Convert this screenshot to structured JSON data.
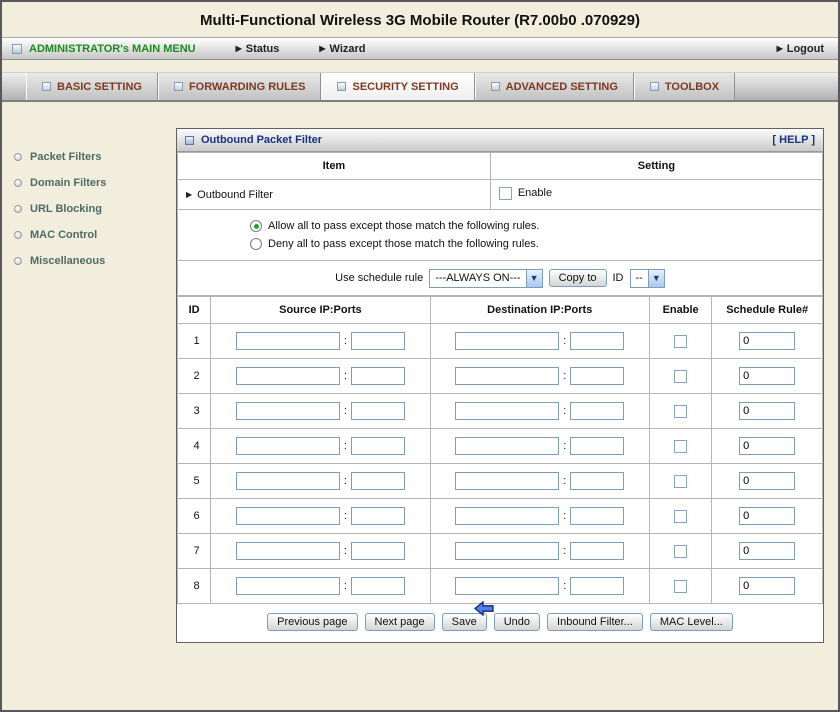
{
  "title": "Multi-Functional Wireless 3G Mobile Router (R7.00b0 .070929)",
  "menubar": {
    "main_menu": "ADMINISTRATOR's MAIN MENU",
    "status": "Status",
    "wizard": "Wizard",
    "logout": "Logout"
  },
  "tabs": [
    {
      "label": "BASIC SETTING",
      "active": false
    },
    {
      "label": "FORWARDING RULES",
      "active": false
    },
    {
      "label": "SECURITY SETTING",
      "active": true
    },
    {
      "label": "ADVANCED SETTING",
      "active": false
    },
    {
      "label": "TOOLBOX",
      "active": false
    }
  ],
  "sidebar": {
    "items": [
      {
        "label": "Packet Filters"
      },
      {
        "label": "Domain Filters"
      },
      {
        "label": "URL Blocking"
      },
      {
        "label": "MAC Control"
      },
      {
        "label": "Miscellaneous"
      }
    ]
  },
  "panel": {
    "title": "Outbound Packet Filter",
    "help": "[ HELP ]",
    "columns": {
      "item": "Item",
      "setting": "Setting"
    },
    "outbound_filter": {
      "label": "Outbound Filter",
      "enable_label": "Enable",
      "enabled": false
    },
    "policy": {
      "allow": {
        "label": "Allow all to pass except those match the following rules.",
        "selected": true
      },
      "deny": {
        "label": "Deny all to pass except those match the following rules.",
        "selected": false
      }
    },
    "schedule": {
      "label": "Use schedule rule",
      "value": "---ALWAYS ON---",
      "copy_button": "Copy to",
      "id_label": "ID",
      "id_value": "--"
    },
    "rules": {
      "headers": {
        "id": "ID",
        "source": "Source IP:Ports",
        "destination": "Destination IP:Ports",
        "enable": "Enable",
        "schedule": "Schedule Rule#"
      },
      "rows": [
        {
          "id": "1",
          "source_ip": "",
          "source_ports": "",
          "dest_ip": "",
          "dest_ports": "",
          "enabled": false,
          "schedule_rule": "0"
        },
        {
          "id": "2",
          "source_ip": "",
          "source_ports": "",
          "dest_ip": "",
          "dest_ports": "",
          "enabled": false,
          "schedule_rule": "0"
        },
        {
          "id": "3",
          "source_ip": "",
          "source_ports": "",
          "dest_ip": "",
          "dest_ports": "",
          "enabled": false,
          "schedule_rule": "0"
        },
        {
          "id": "4",
          "source_ip": "",
          "source_ports": "",
          "dest_ip": "",
          "dest_ports": "",
          "enabled": false,
          "schedule_rule": "0"
        },
        {
          "id": "5",
          "source_ip": "",
          "source_ports": "",
          "dest_ip": "",
          "dest_ports": "",
          "enabled": false,
          "schedule_rule": "0"
        },
        {
          "id": "6",
          "source_ip": "",
          "source_ports": "",
          "dest_ip": "",
          "dest_ports": "",
          "enabled": false,
          "schedule_rule": "0"
        },
        {
          "id": "7",
          "source_ip": "",
          "source_ports": "",
          "dest_ip": "",
          "dest_ports": "",
          "enabled": false,
          "schedule_rule": "0"
        },
        {
          "id": "8",
          "source_ip": "",
          "source_ports": "",
          "dest_ip": "",
          "dest_ports": "",
          "enabled": false,
          "schedule_rule": "0"
        }
      ]
    },
    "buttons": {
      "previous": "Previous page",
      "next": "Next page",
      "save": "Save",
      "undo": "Undo",
      "inbound": "Inbound Filter...",
      "mac": "MAC Level..."
    }
  }
}
